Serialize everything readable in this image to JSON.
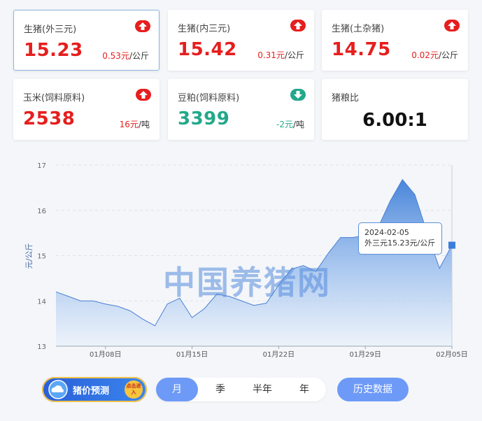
{
  "cards": [
    {
      "name": "生猪(外三元)",
      "price": "15.23",
      "change_num": "0.53元",
      "change_unit": "/公斤",
      "trend": "up",
      "icon": "up-arrow-icon"
    },
    {
      "name": "生猪(内三元)",
      "price": "15.42",
      "change_num": "0.31元",
      "change_unit": "/公斤",
      "trend": "up",
      "icon": "up-arrow-icon"
    },
    {
      "name": "生猪(土杂猪)",
      "price": "14.75",
      "change_num": "0.02元",
      "change_unit": "/公斤",
      "trend": "up",
      "icon": "up-arrow-icon"
    },
    {
      "name": "玉米(饲料原料)",
      "price": "2538",
      "change_num": "16元",
      "change_unit": "/吨",
      "trend": "up",
      "icon": "up-arrow-icon"
    },
    {
      "name": "豆粕(饲料原料)",
      "price": "3399",
      "change_num": "-2元",
      "change_unit": "/吨",
      "trend": "down",
      "icon": "down-arrow-icon"
    },
    {
      "name": "猪粮比",
      "price": "6.00:1"
    }
  ],
  "colors": {
    "up": "#e61e1e",
    "down": "#23a88a",
    "accent": "#6e9af7",
    "line": "#4a7fd4"
  },
  "chart_data": {
    "type": "area",
    "ylabel": "元/公斤",
    "ylim": [
      13,
      17
    ],
    "yticks": [
      "13",
      "14",
      "15",
      "16",
      "17"
    ],
    "xticks": [
      "01月08日",
      "01月15日",
      "01月22日",
      "01月29日",
      "02月05日"
    ],
    "x": [
      "2024-01-04",
      "2024-01-05",
      "2024-01-06",
      "2024-01-07",
      "2024-01-08",
      "2024-01-09",
      "2024-01-10",
      "2024-01-11",
      "2024-01-12",
      "2024-01-13",
      "2024-01-14",
      "2024-01-15",
      "2024-01-16",
      "2024-01-17",
      "2024-01-18",
      "2024-01-19",
      "2024-01-20",
      "2024-01-21",
      "2024-01-22",
      "2024-01-23",
      "2024-01-24",
      "2024-01-25",
      "2024-01-26",
      "2024-01-27",
      "2024-01-28",
      "2024-01-29",
      "2024-01-30",
      "2024-01-31",
      "2024-02-01",
      "2024-02-02",
      "2024-02-03",
      "2024-02-04",
      "2024-02-05"
    ],
    "series": [
      {
        "values": [
          14.2,
          14.1,
          14.0,
          14.0,
          13.93,
          13.88,
          13.78,
          13.6,
          13.45,
          13.93,
          14.06,
          13.63,
          13.83,
          14.15,
          14.1,
          14.0,
          13.9,
          13.95,
          14.35,
          14.7,
          14.78,
          14.65,
          15.05,
          15.4,
          15.4,
          15.45,
          15.6,
          16.2,
          16.68,
          16.35,
          15.5,
          14.72,
          15.23
        ]
      }
    ],
    "tooltip": {
      "date": "2024-02-05",
      "label": "外三元15.23元/公斤"
    },
    "watermark": "中国养猪网"
  },
  "promo": {
    "label": "猪价预测",
    "seal": "点击进入"
  },
  "periods": [
    "月",
    "季",
    "半年",
    "年"
  ],
  "active_period": "月",
  "history_label": "历史数据"
}
